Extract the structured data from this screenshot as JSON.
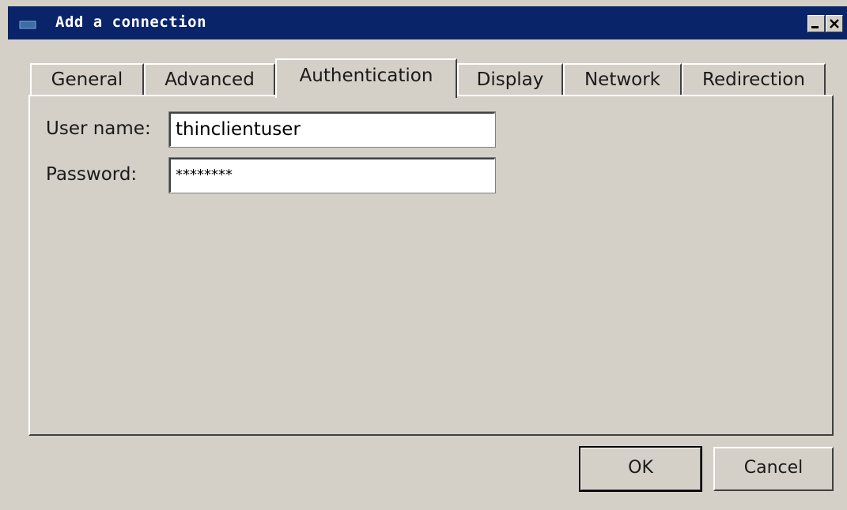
{
  "window": {
    "title": "Add a connection",
    "titlebar_color": "#0a246a",
    "face_color": "#d4d0c8",
    "icons": [
      "window-menu-icon",
      "minimize-icon",
      "close-icon"
    ]
  },
  "tabs": [
    {
      "label": "General",
      "active": false
    },
    {
      "label": "Advanced",
      "active": false
    },
    {
      "label": "Authentication",
      "active": true
    },
    {
      "label": "Display",
      "active": false
    },
    {
      "label": "Network",
      "active": false
    },
    {
      "label": "Redirection",
      "active": false
    }
  ],
  "form": {
    "username_label": "User name:",
    "username_value": "thinclientuser",
    "password_label": "Password:",
    "password_value": "********"
  },
  "buttons": {
    "ok": "OK",
    "cancel": "Cancel"
  }
}
